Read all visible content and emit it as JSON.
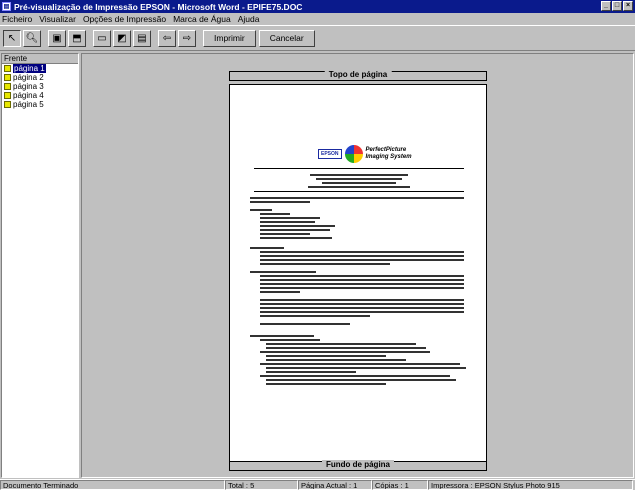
{
  "window": {
    "title": "Pré-visualização de Impressão EPSON - Microsoft Word - EPIFE75.DOC",
    "controls": [
      "_",
      "□",
      "×"
    ]
  },
  "menu": [
    "Ficheiro",
    "Visualizar",
    "Opções de Impressão",
    "Marca de Água",
    "Ajuda"
  ],
  "toolbar": {
    "icons": [
      "cursor-icon",
      "magnify-icon",
      "fit-page-icon",
      "fit-width-icon",
      "printable-area-icon",
      "watermark-icon",
      "add-page-icon",
      "previous-page-icon",
      "next-page-icon"
    ],
    "print_label": "Imprimir",
    "cancel_label": "Cancelar"
  },
  "sidebar": {
    "header": "Frente",
    "pages": [
      "página 1",
      "página 2",
      "página 3",
      "página 4",
      "página 5"
    ],
    "selected_index": 0
  },
  "preview": {
    "top_margin_label": "Topo de página",
    "bottom_margin_label": "Fundo de página",
    "logo_brand": "EPSON",
    "logo_line1": "PerfectPicture",
    "logo_line2": "Imaging System"
  },
  "status": {
    "state": "Documento Terminado",
    "total": "Total : 5",
    "current_page": "Página Actual : 1",
    "copies": "Cópias : 1",
    "printer": "Impressora : EPSON Stylus Photo 915"
  },
  "colors": {
    "title_bar": "#0a1a8c",
    "selection": "#000080",
    "face": "#c0c0c0"
  }
}
